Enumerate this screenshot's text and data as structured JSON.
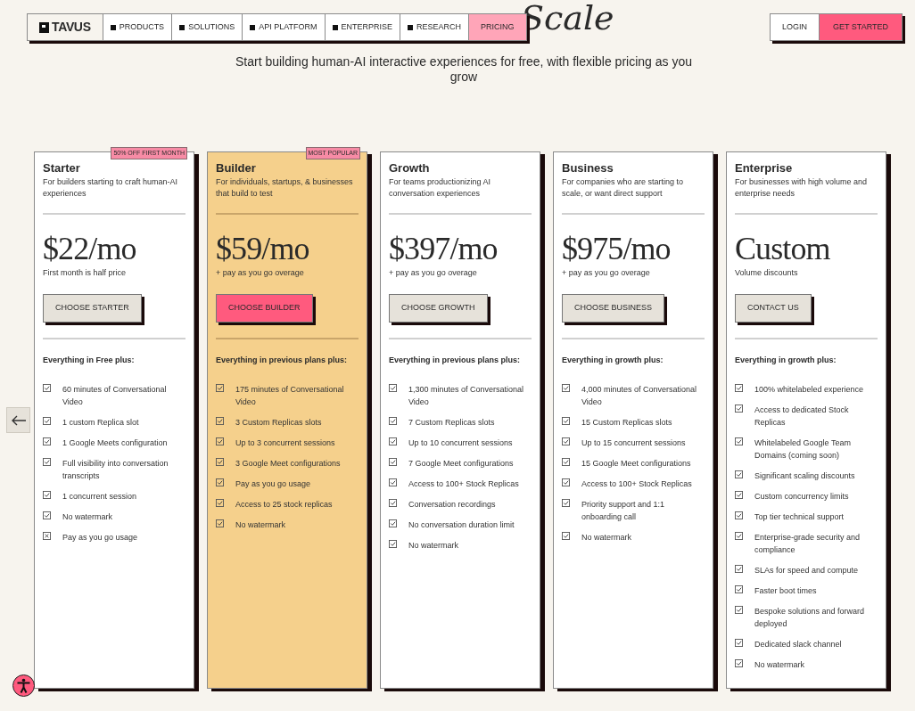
{
  "heading": "Scale",
  "nav": {
    "logo": "TAVUS",
    "items": [
      {
        "label": "PRODUCTS",
        "selected": false
      },
      {
        "label": "SOLUTIONS",
        "selected": false
      },
      {
        "label": "API PLATFORM",
        "selected": false
      },
      {
        "label": "ENTERPRISE",
        "selected": false
      },
      {
        "label": "RESEARCH",
        "selected": false
      },
      {
        "label": "PRICING",
        "selected": true
      }
    ],
    "login": "LOGIN",
    "cta": "GET STARTED"
  },
  "subtitle": "Start building human-AI interactive experiences for free, with flexible pricing as you grow",
  "plans": [
    {
      "name": "Starter",
      "badge": "50% OFF FIRST MONTH",
      "highlighted": false,
      "description": "For builders starting to craft human-AI experiences",
      "price": "$22/mo",
      "note": "First month is half price",
      "button": "CHOOSE STARTER",
      "features_title": "Everything in Free plus:",
      "features": [
        {
          "text": "60 minutes of Conversational Video",
          "included": true
        },
        {
          "text": "1 custom Replica slot",
          "included": true
        },
        {
          "text": "1 Google Meets configuration",
          "included": true
        },
        {
          "text": "Full visibility into conversation transcripts",
          "included": true
        },
        {
          "text": "1 concurrent session",
          "included": true
        },
        {
          "text": "No watermark",
          "included": true
        },
        {
          "text": "Pay as you go usage",
          "included": false
        }
      ]
    },
    {
      "name": "Builder",
      "badge": "MOST POPULAR",
      "highlighted": true,
      "description": "For individuals, startups, & businesses that build to test",
      "price": "$59/mo",
      "note": "+ pay as you go overage",
      "button": "CHOOSE BUILDER",
      "features_title": "Everything in previous plans plus:",
      "features": [
        {
          "text": "175 minutes of Conversational Video",
          "included": true
        },
        {
          "text": "3 Custom Replicas slots",
          "included": true
        },
        {
          "text": "Up to 3 concurrent sessions",
          "included": true
        },
        {
          "text": "3 Google Meet configurations",
          "included": true
        },
        {
          "text": "Pay as you go usage",
          "included": true
        },
        {
          "text": "Access to 25 stock replicas",
          "included": true
        },
        {
          "text": "No watermark",
          "included": true
        }
      ]
    },
    {
      "name": "Growth",
      "highlighted": false,
      "description": "For teams productionizing AI conversation experiences",
      "price": "$397/mo",
      "note": "+ pay as you go overage",
      "button": "CHOOSE GROWTH",
      "features_title": "Everything in previous plans plus:",
      "features": [
        {
          "text": "1,300 minutes of Conversational Video",
          "included": true
        },
        {
          "text": "7 Custom Replicas slots",
          "included": true
        },
        {
          "text": "Up to 10 concurrent sessions",
          "included": true
        },
        {
          "text": "7 Google Meet configurations",
          "included": true
        },
        {
          "text": "Access to 100+ Stock Replicas",
          "included": true
        },
        {
          "text": "Conversation recordings",
          "included": true
        },
        {
          "text": "No conversation duration limit",
          "included": true
        },
        {
          "text": "No watermark",
          "included": true
        }
      ]
    },
    {
      "name": "Business",
      "highlighted": false,
      "description": "For companies who are starting to scale, or want direct support",
      "price": "$975/mo",
      "note": "+ pay as you go overage",
      "button": "CHOOSE BUSINESS",
      "features_title": "Everything in growth plus:",
      "features": [
        {
          "text": "4,000 minutes of Conversational Video",
          "included": true
        },
        {
          "text": "15 Custom Replicas slots",
          "included": true
        },
        {
          "text": "Up to 15 concurrent sessions",
          "included": true
        },
        {
          "text": "15 Google Meet configurations",
          "included": true
        },
        {
          "text": "Access to 100+ Stock Replicas",
          "included": true
        },
        {
          "text": "Priority support and 1:1 onboarding call",
          "included": true
        },
        {
          "text": "No watermark",
          "included": true
        }
      ]
    },
    {
      "name": "Enterprise",
      "highlighted": false,
      "description": "For businesses with high volume and enterprise needs",
      "price": "Custom",
      "note": "Volume discounts",
      "button": "CONTACT US",
      "features_title": "Everything in growth plus:",
      "features": [
        {
          "text": "100% whitelabeled experience",
          "included": true
        },
        {
          "text": "Access to dedicated Stock Replicas",
          "included": true
        },
        {
          "text": "Whitelabeled Google Team Domains (coming soon)",
          "included": true
        },
        {
          "text": "Significant scaling discounts",
          "included": true
        },
        {
          "text": "Custom concurrency limits",
          "included": true
        },
        {
          "text": "Top tier technical support",
          "included": true
        },
        {
          "text": "Enterprise-grade security and compliance",
          "included": true
        },
        {
          "text": "SLAs for speed and compute",
          "included": true
        },
        {
          "text": "Faster boot times",
          "included": true
        },
        {
          "text": "Bespoke solutions and forward deployed",
          "included": true
        },
        {
          "text": "Dedicated slack channel",
          "included": true
        },
        {
          "text": "No watermark",
          "included": true
        }
      ]
    }
  ]
}
